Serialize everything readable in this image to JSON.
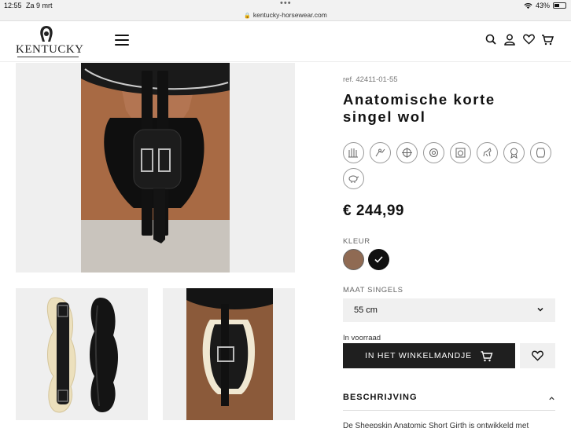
{
  "status_bar": {
    "time": "12:55",
    "date": "Za 9 mrt",
    "url": "kentucky-horsewear.com",
    "battery": "43%"
  },
  "header": {
    "logo_text": "KENTUCKY"
  },
  "product": {
    "ref": "ref. 42411-01-55",
    "title_line1": "Anatomische korte",
    "title_line2": "singel wol",
    "price": "€ 244,99",
    "color_label": "KLEUR",
    "colors": [
      "#8f6a53",
      "#111111"
    ],
    "size_label": "MAAT SINGELS",
    "size_value": "55 cm",
    "stock": "In voorraad",
    "add_to_cart": "IN HET WINKELMANDJE",
    "description_heading": "BESCHRIJVING",
    "description_text": "De Sheepskin Anatomic Short Girth is ontwikkeld met"
  }
}
